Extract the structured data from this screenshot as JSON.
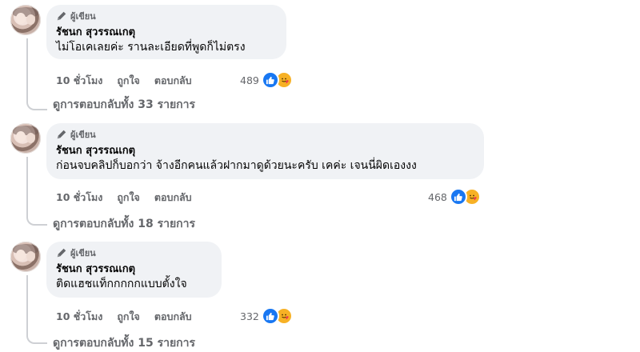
{
  "comments": [
    {
      "badge": "ผู้เขียน",
      "author": "รัชนก สุวรรณเกตุ",
      "text": "ไม่โอเคเลยค่ะ รานละเอียดที่พูดก็ไม่ตรง",
      "time": "10 ชั่วโมง",
      "like_label": "ถูกใจ",
      "reply_label": "ตอบกลับ",
      "reaction_count": "489",
      "view_replies": "ดูการตอบกลับทั้ง 33 รายการ"
    },
    {
      "badge": "ผู้เขียน",
      "author": "รัชนก สุวรรณเกตุ",
      "text": "ก่อนจบคลิปก็บอกว่า จ้างอีกคนแล้วฝากมาดูด้วยนะครับ เคค่ะ เจนนี่ผิดเองงง",
      "time": "10 ชั่วโมง",
      "like_label": "ถูกใจ",
      "reply_label": "ตอบกลับ",
      "reaction_count": "468",
      "view_replies": "ดูการตอบกลับทั้ง 18 รายการ"
    },
    {
      "badge": "ผู้เขียน",
      "author": "รัชนก สุวรรณเกตุ",
      "text": "ติดแฮชแท็กกกกกแบบตั้งใจ",
      "time": "10 ชั่วโมง",
      "like_label": "ถูกใจ",
      "reply_label": "ตอบกลับ",
      "reaction_count": "332",
      "view_replies": "ดูการตอบกลับทั้ง 15 รายการ"
    }
  ],
  "icons": {
    "badge": "pen-icon",
    "reaction_1": "like-icon",
    "reaction_2": "care-icon"
  },
  "colors": {
    "bubble": "#f0f2f5",
    "secondary_text": "#65676b",
    "like_blue": "#1877f2",
    "care_yellow": "#f7b125"
  }
}
